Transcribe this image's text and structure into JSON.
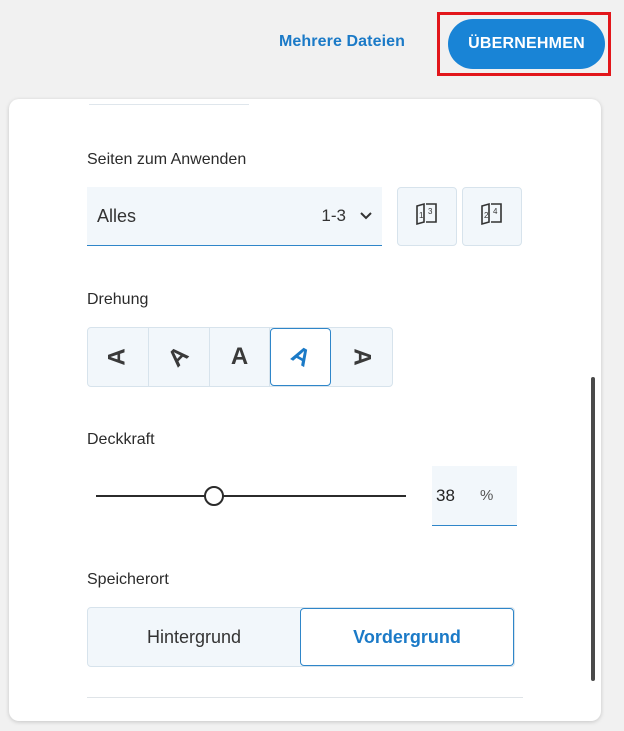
{
  "header": {
    "multi_files_label": "Mehrere Dateien",
    "apply_label": "ÜBERNEHMEN"
  },
  "pages": {
    "label": "Seiten zum Anwenden",
    "selected": "Alles",
    "range": "1-3"
  },
  "rotation": {
    "label": "Drehung",
    "options": [
      "A",
      "A",
      "A",
      "A",
      "A"
    ],
    "active_index": 3
  },
  "opacity": {
    "label": "Deckkraft",
    "value": "38",
    "unit": "%",
    "level_percent": 38
  },
  "location": {
    "label": "Speicherort",
    "options": [
      "Hintergrund",
      "Vordergrund"
    ],
    "active": "Vordergrund"
  },
  "colors": {
    "accent": "#1984d6",
    "highlight": "#e2161b"
  }
}
